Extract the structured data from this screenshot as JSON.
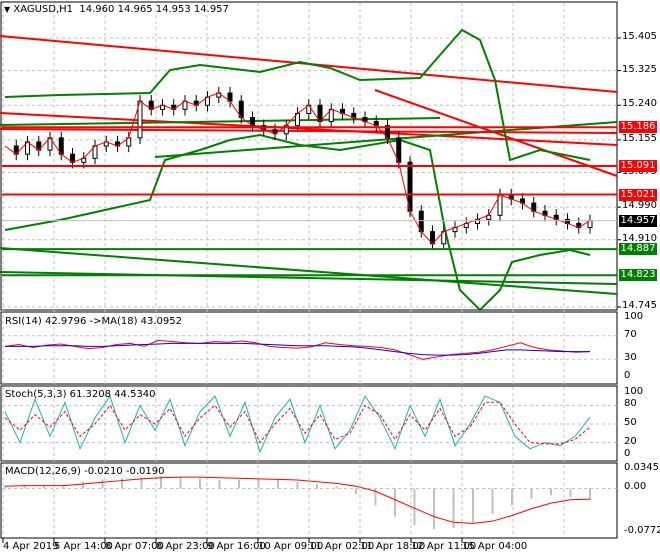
{
  "header": {
    "symbol": "XAGUSD,H1",
    "ohlc": "14.960 14.965 14.953 14.957"
  },
  "chart_data": [
    {
      "type": "line",
      "title": "XAGUSD,H1",
      "ylim": [
        14.72,
        15.47
      ],
      "y_ticks": [
        "15.405",
        "15.325",
        "15.240",
        "15.155",
        "15.075",
        "14.990",
        "14.910",
        "14.745"
      ],
      "x_ticks": [
        "4 Apr 2019",
        "5 Apr 14:00",
        "8 Apr 07:00",
        "8 Apr 23:00",
        "9 Apr 16:00",
        "10 Apr 09:00",
        "11 Apr 02:00",
        "11 Apr 18:00",
        "12 Apr 11:00",
        "15 Apr 04:00"
      ],
      "close": [
        15.14,
        15.12,
        15.15,
        15.13,
        15.16,
        15.12,
        15.1,
        15.11,
        15.14,
        15.15,
        15.14,
        15.16,
        15.25,
        15.23,
        15.24,
        15.23,
        15.25,
        15.24,
        15.26,
        15.27,
        15.25,
        15.21,
        15.19,
        15.18,
        15.17,
        15.19,
        15.22,
        15.24,
        15.2,
        15.23,
        15.22,
        15.21,
        15.2,
        15.19,
        15.16,
        15.1,
        14.98,
        14.93,
        14.9,
        14.93,
        14.94,
        14.95,
        14.96,
        14.97,
        15.02,
        15.01,
        15.0,
        14.98,
        14.97,
        14.96,
        14.95,
        14.94,
        14.957
      ],
      "levels": [
        {
          "value": "15.186",
          "color": "#ff0000"
        },
        {
          "value": "15.091",
          "color": "#ff0000"
        },
        {
          "value": "15.021",
          "color": "#ff0000"
        },
        {
          "value": "14.887",
          "color": "#008000"
        },
        {
          "value": "14.823",
          "color": "#008000"
        }
      ],
      "current": {
        "value": "14.957",
        "color": "#000000"
      }
    },
    {
      "type": "line",
      "title": "RSI(14) 42.9796  ->MA(18) 43.0952",
      "ylim": [
        0,
        100
      ],
      "y_ticks": [
        "100",
        "70",
        "30",
        "0"
      ],
      "rsi": [
        52,
        55,
        50,
        54,
        56,
        52,
        48,
        50,
        55,
        57,
        52,
        62,
        60,
        58,
        57,
        60,
        59,
        61,
        58,
        52,
        50,
        49,
        51,
        58,
        55,
        53,
        52,
        50,
        46,
        38,
        30,
        34,
        38,
        40,
        42,
        46,
        52,
        58,
        50,
        46,
        44,
        42,
        43
      ],
      "ma": [
        52,
        52,
        52,
        53,
        53,
        53,
        52,
        52,
        53,
        54,
        55,
        56,
        57,
        57,
        57,
        57,
        57,
        57,
        56,
        55,
        54,
        53,
        53,
        53,
        52,
        51,
        49,
        46,
        43,
        40,
        38,
        37,
        37,
        38,
        40,
        43,
        46,
        46,
        45,
        44,
        43,
        43,
        43
      ]
    },
    {
      "type": "line",
      "title": "Stoch(5,3,3) 61.3208 44.5340",
      "ylim": [
        0,
        100
      ],
      "y_ticks": [
        "100",
        "80",
        "50",
        "20",
        "0"
      ],
      "main": [
        70,
        20,
        90,
        30,
        85,
        10,
        60,
        95,
        20,
        80,
        40,
        90,
        15,
        70,
        95,
        30,
        85,
        5,
        60,
        90,
        20,
        80,
        10,
        40,
        95,
        60,
        10,
        80,
        30,
        90,
        15,
        50,
        95,
        85,
        30,
        10,
        20,
        15,
        30,
        61
      ],
      "signal": [
        60,
        40,
        65,
        45,
        70,
        30,
        50,
        80,
        40,
        65,
        50,
        75,
        30,
        60,
        80,
        45,
        70,
        20,
        50,
        75,
        35,
        65,
        25,
        35,
        80,
        65,
        25,
        65,
        40,
        75,
        30,
        45,
        85,
        85,
        50,
        20,
        18,
        18,
        25,
        45
      ]
    },
    {
      "type": "bar",
      "title": "MACD(12,26,9) -0.0210 -0.0190",
      "ylim": [
        -0.0772,
        0.0345
      ],
      "y_ticks": [
        "0.0345",
        "0.00",
        "-0.0772"
      ],
      "macd": [
        0.005,
        0.006,
        0.004,
        0.005,
        0.012,
        0.016,
        0.018,
        0.02,
        0.022,
        0.021,
        0.018,
        0.016,
        0.015,
        0.016,
        0.015,
        0.012,
        0.008,
        0.004,
        -0.01,
        -0.03,
        -0.05,
        -0.065,
        -0.072,
        -0.07,
        -0.06,
        -0.045,
        -0.03,
        -0.018,
        -0.012,
        -0.015,
        -0.021
      ],
      "signal": [
        0.004,
        0.005,
        0.005,
        0.005,
        0.008,
        0.011,
        0.014,
        0.017,
        0.019,
        0.02,
        0.02,
        0.019,
        0.018,
        0.017,
        0.016,
        0.015,
        0.012,
        0.009,
        0.004,
        -0.005,
        -0.02,
        -0.035,
        -0.05,
        -0.06,
        -0.062,
        -0.058,
        -0.048,
        -0.036,
        -0.026,
        -0.02,
        -0.019
      ]
    }
  ],
  "colors": {
    "up": "#008000",
    "bands": "#008000",
    "level_red": "#ff0000",
    "level_green": "#008000",
    "rsi": "#ff0000",
    "rsi_ma": "#0000ff",
    "stoch_main": "#20b2aa",
    "stoch_signal": "#ff0000",
    "macd_hist": "#c0c0c0"
  }
}
